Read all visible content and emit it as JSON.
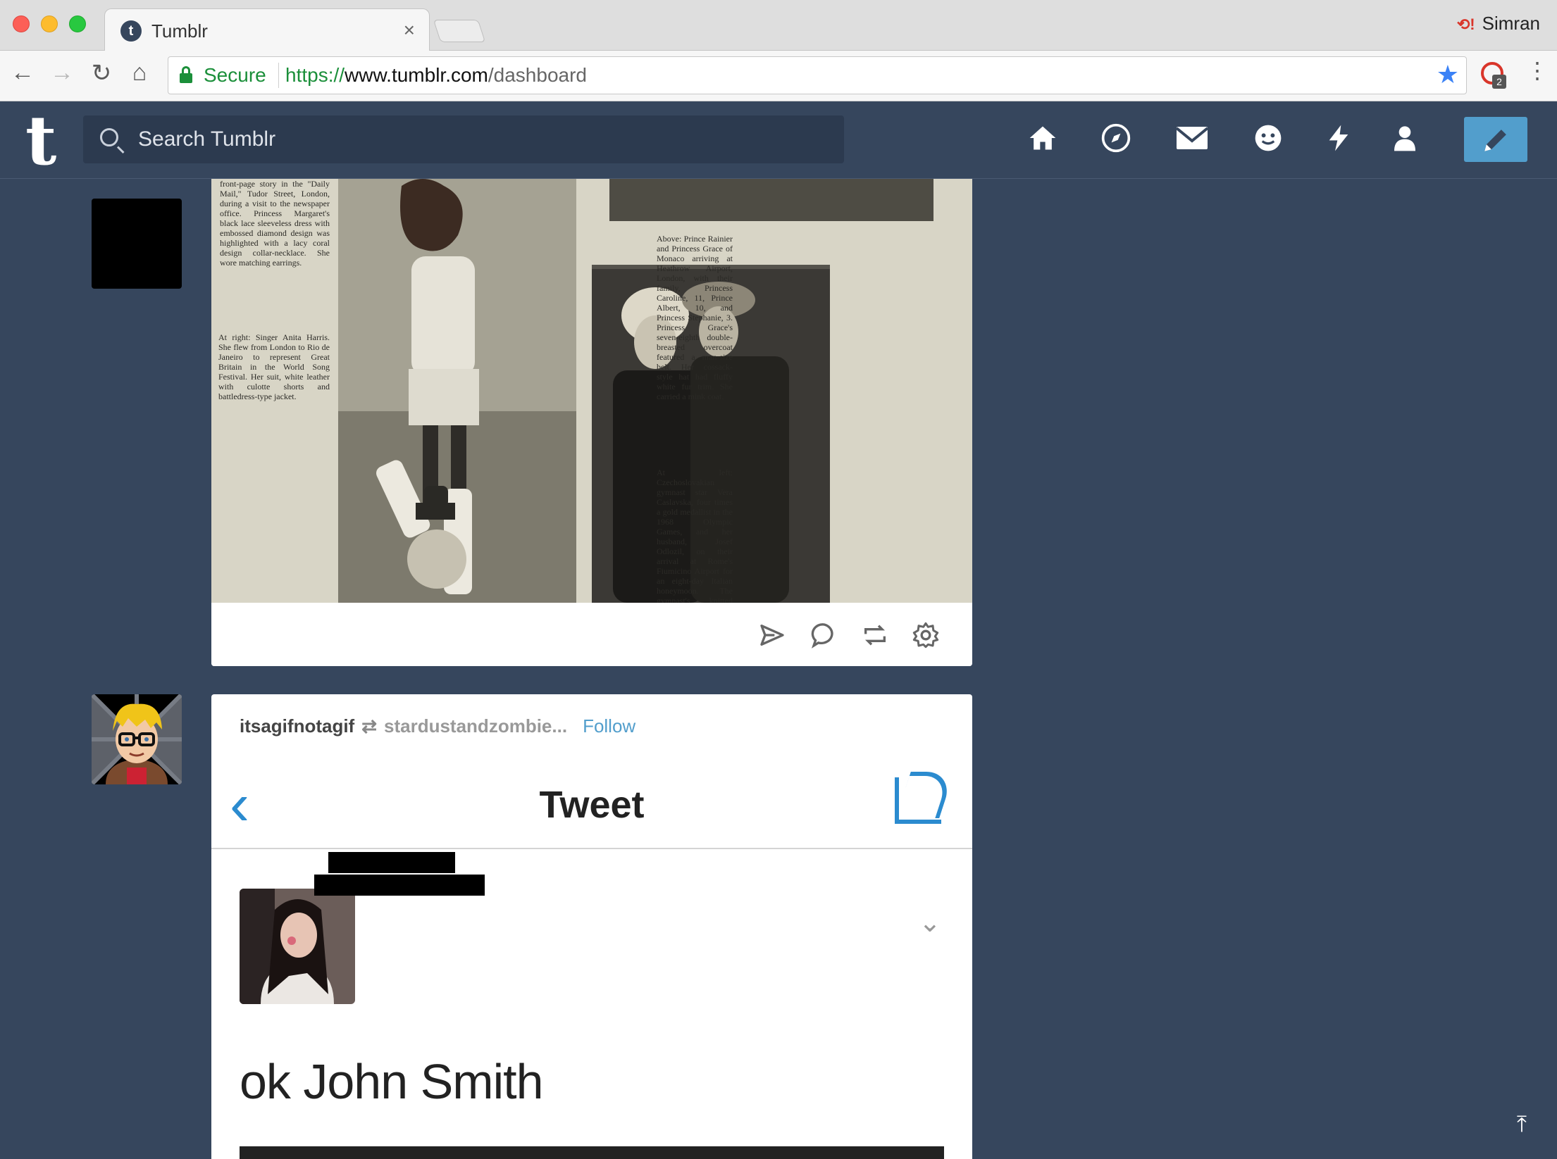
{
  "browser": {
    "tab_title": "Tumblr",
    "tab_close": "×",
    "tab_favicon": "t",
    "profile_name": "Simran",
    "profile_icon": "sync-error-icon",
    "secure_label": "Secure",
    "url_scheme": "https://",
    "url_host": "www.tumblr.com",
    "url_path": "/dashboard",
    "extension_badge": "2"
  },
  "header": {
    "logo": "t",
    "search_placeholder": "Search Tumblr",
    "nav_icons": [
      "home-icon",
      "explore-icon",
      "inbox-icon",
      "messaging-icon",
      "activity-icon",
      "account-icon"
    ],
    "compose_icon": "pencil-icon",
    "accent": "#529ecc",
    "background": "#36465d"
  },
  "post1": {
    "scan_text_1": "front-page story in the \"Daily Mail,\" Tudor Street, London, during a visit to the newspaper office. Princess Margaret's black lace sleeveless dress with embossed diamond design was highlighted with a lacy coral design collar-necklace. She wore matching earrings.",
    "scan_text_2": "At right: Singer Anita Harris. She flew from London to Rio de Janeiro to represent Great Britain in the World Song Festival. Her suit, white leather with culotte shorts and battledress-type jacket.",
    "scan_text_3": "Above: Prince Rainier and Princess Grace of Monaco arriving at Heathrow Airport, London, with their family, Princess Caroline, 11, Prince Albert, 10, and Princess Stephanie, 3. Princess Grace's seven-eighth double-breasted overcoat featured a man-size belt. Her cossack-style hat had fluffy white fur trim. She carried a mink coat.",
    "scan_text_4": "At left: Czechoslovakian gymnast star Vera Caslavska, four times a gold medallist in the 1968 Olympic Games, and her husband, Josef Odlozil, on their arrival at Rome's Fiumicino Airport for an eight-day Italian honeymoon. The gymnast's knitted coat, buttoned slightly to the left, featured a fur trim at"
  },
  "post2": {
    "author": "itsagifnotagif",
    "source": "stardustandzombie...",
    "follow_label": "Follow",
    "tweet_header": "Tweet",
    "tweet_text": "ok John Smith"
  }
}
